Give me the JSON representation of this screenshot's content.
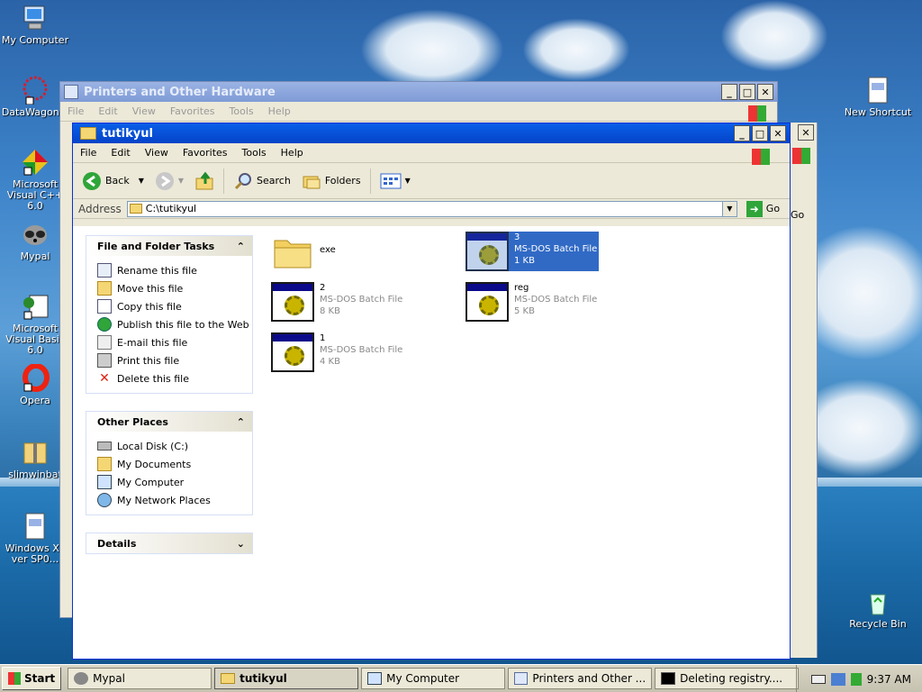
{
  "desktop": {
    "icons": [
      {
        "label": "My Computer"
      },
      {
        "label": "DataWagon..."
      },
      {
        "label": "Microsoft Visual C++ 6.0"
      },
      {
        "label": "Mypal"
      },
      {
        "label": "Microsoft Visual Basic 6.0"
      },
      {
        "label": "Opera"
      },
      {
        "label": "slimwinbat"
      },
      {
        "label": "Windows XP ver SP0..."
      },
      {
        "label": "New Shortcut"
      },
      {
        "label": "Recycle Bin"
      }
    ]
  },
  "back_window": {
    "title": "Printers and Other Hardware",
    "menu": [
      "File",
      "Edit",
      "View",
      "Favorites",
      "Tools",
      "Help"
    ],
    "go_label": "Go"
  },
  "main_window": {
    "title": "tutikyul",
    "menu": [
      "File",
      "Edit",
      "View",
      "Favorites",
      "Tools",
      "Help"
    ],
    "toolbar": {
      "back": "Back",
      "search": "Search",
      "folders": "Folders"
    },
    "address": {
      "label": "Address",
      "value": "C:\\tutikyul",
      "go": "Go"
    },
    "tasks": {
      "header": "File and Folder Tasks",
      "items": [
        "Rename this file",
        "Move this file",
        "Copy this file",
        "Publish this file to the Web",
        "E-mail this file",
        "Print this file",
        "Delete this file"
      ]
    },
    "places": {
      "header": "Other Places",
      "items": [
        "Local Disk (C:)",
        "My Documents",
        "My Computer",
        "My Network Places"
      ]
    },
    "details": {
      "header": "Details"
    },
    "files": [
      {
        "name": "exe",
        "type": "",
        "size": ""
      },
      {
        "name": "3",
        "type": "MS-DOS Batch File",
        "size": "1 KB"
      },
      {
        "name": "2",
        "type": "MS-DOS Batch File",
        "size": "8 KB"
      },
      {
        "name": "reg",
        "type": "MS-DOS Batch File",
        "size": "5 KB"
      },
      {
        "name": "1",
        "type": "MS-DOS Batch File",
        "size": "4 KB"
      }
    ]
  },
  "taskbar": {
    "start": "Start",
    "tasks": [
      "Mypal",
      "tutikyul",
      "My Computer",
      "Printers and Other ...",
      "Deleting registry...."
    ],
    "clock": "9:37 AM"
  },
  "colors": {
    "titlebar": "#0a53e3",
    "selection": "#316ac5",
    "accent_green": "#2fa53a"
  }
}
